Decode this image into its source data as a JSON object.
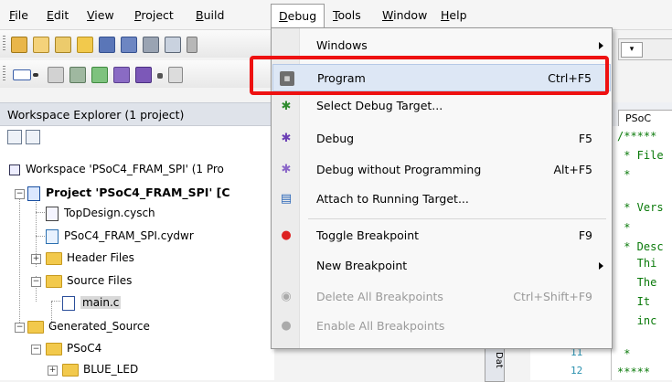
{
  "menubar": [
    {
      "label": "File",
      "u": "F",
      "rest": "ile"
    },
    {
      "label": "Edit",
      "u": "E",
      "rest": "dit"
    },
    {
      "label": "View",
      "u": "V",
      "rest": "iew"
    },
    {
      "label": "Project",
      "u": "P",
      "rest": "roject"
    },
    {
      "label": "Build",
      "u": "B",
      "rest": "uild"
    },
    {
      "label": "Debug",
      "u": "D",
      "rest": "ebug"
    },
    {
      "label": "Tools",
      "u": "T",
      "rest": "ools"
    },
    {
      "label": "Window",
      "u": "W",
      "rest": "indow"
    },
    {
      "label": "Help",
      "u": "H",
      "rest": "elp"
    }
  ],
  "explorer": {
    "title": "Workspace Explorer (1 project)",
    "workspace": "Workspace 'PSoC4_FRAM_SPI' (1 Pro",
    "project": "Project 'PSoC4_FRAM_SPI' [C",
    "items": {
      "topdesign": "TopDesign.cysch",
      "cydwr": "PSoC4_FRAM_SPI.cydwr",
      "header_files": "Header Files",
      "source_files": "Source Files",
      "main_c": "main.c",
      "generated_source": "Generated_Source",
      "psoc4": "PSoC4",
      "blue_led": "BLUE_LED"
    }
  },
  "editor": {
    "tab": "PSoC",
    "lines": [
      "/*****",
      " * File",
      " *",
      " * Vers",
      " *",
      " * Desc",
      "   Thi",
      "   The",
      "   It ",
      "   inc",
      " *",
      "*****"
    ],
    "line_numbers": [
      "11",
      "12"
    ],
    "side_tab": "Dat"
  },
  "debug_menu": {
    "windows": "Windows",
    "program": "Program",
    "program_sc": "Ctrl+F5",
    "select_target": "Select Debug Target...",
    "debug": "Debug",
    "debug_sc": "F5",
    "debug_noprog": "Debug without Programming",
    "debug_noprog_sc": "Alt+F5",
    "attach": "Attach to Running Target...",
    "toggle_bp": "Toggle Breakpoint",
    "toggle_bp_sc": "F9",
    "new_bp": "New Breakpoint",
    "delete_bp": "Delete All Breakpoints",
    "delete_bp_sc": "Ctrl+Shift+F9",
    "enable_bp": "Enable All Breakpoints"
  },
  "toolbar_right": {
    "dropdown": "▾"
  },
  "colors": {
    "highlight_box": "#ee1111",
    "menu_bg": "#f8f8f8",
    "hover": "#dde7f5"
  }
}
